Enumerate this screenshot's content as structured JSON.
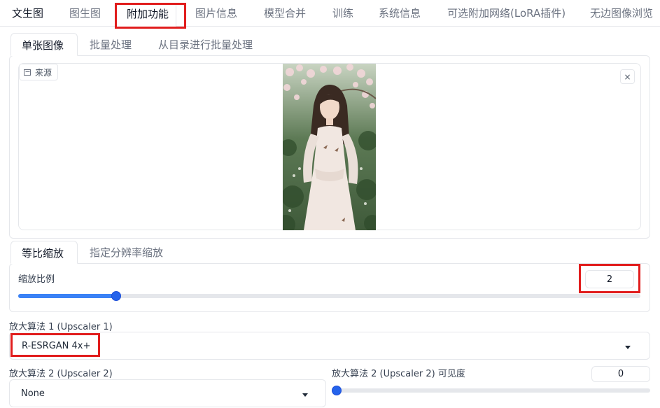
{
  "top_tabs": [
    {
      "label": "文生图"
    },
    {
      "label": "图生图"
    },
    {
      "label": "附加功能"
    },
    {
      "label": "图片信息"
    },
    {
      "label": "模型合并"
    },
    {
      "label": "训练"
    },
    {
      "label": "系统信息"
    },
    {
      "label": "可选附加网络(LoRA插件)"
    },
    {
      "label": "无边图像浏览"
    }
  ],
  "sub_tabs": [
    {
      "label": "单张图像"
    },
    {
      "label": "批量处理"
    },
    {
      "label": "从目录进行批量处理"
    }
  ],
  "image_panel": {
    "source_label": "来源",
    "close_symbol": "×"
  },
  "resize_tabs": [
    {
      "label": "等比缩放"
    },
    {
      "label": "指定分辨率缩放"
    }
  ],
  "scale": {
    "label": "缩放比例",
    "value": "2",
    "fraction": 0.157
  },
  "upscaler1": {
    "label": "放大算法 1 (Upscaler 1)",
    "value": "R-ESRGAN 4x+"
  },
  "upscaler2": {
    "label": "放大算法 2 (Upscaler 2)",
    "value": "None"
  },
  "upscaler2_visibility": {
    "label": "放大算法 2 (Upscaler 2) 可见度",
    "value": "0",
    "fraction": 0.0
  },
  "colors": {
    "accent": "#2563eb",
    "highlight": "#e11d1d"
  }
}
